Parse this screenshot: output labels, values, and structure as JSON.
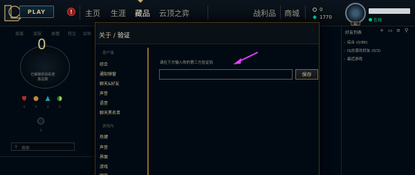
{
  "top_nav": {
    "play_label": "PLAY",
    "alert_glyph": "!",
    "items": [
      "主页",
      "生涯",
      "藏品",
      "云顶之弈"
    ],
    "right_items": [
      "战利品",
      "商城"
    ],
    "active_index": 2,
    "currency": {
      "blue_essence": "0",
      "riot_points": "1770"
    },
    "level_badge": "82",
    "status": "在线"
  },
  "profile_page": {
    "subnav": [
      "英雄",
      "皮肤",
      "表情",
      "符文",
      "召唤"
    ],
    "trophy_count": "0",
    "trophy_text_line1": "已解锁的炫彩皮",
    "trophy_text_line2": "肤总数",
    "token_counts": [
      "0",
      "0",
      "0",
      "0"
    ],
    "coin_count": "0",
    "search_placeholder": "搜索"
  },
  "friends": {
    "header": "好友列表",
    "groups": [
      {
        "label": "综合 (0/86)"
      },
      {
        "label": "DJ总喜欢好友 (0/3)"
      },
      {
        "label": "最近游戏"
      }
    ]
  },
  "modal": {
    "breadcrumb_parent": "关于",
    "breadcrumb_sep": "/",
    "title": "验证",
    "sidebar": {
      "section_client": "客户端",
      "client_items": [
        "综合",
        "通知弹窗",
        "聊天&好友",
        "声音",
        "语音",
        "聊天黑名单"
      ],
      "section_game": "游戏内",
      "game_items": [
        "热键",
        "声音",
        "界面",
        "游戏",
        "回放"
      ]
    },
    "prompt": "请在下方输入你的第三方验证码",
    "input_value": "",
    "save_label": "保存"
  },
  "colors": {
    "gold": "#c8aa6e",
    "gold_text": "#cdbe91",
    "annotation_arrow": "#e040fb",
    "online": "#0acb74"
  }
}
